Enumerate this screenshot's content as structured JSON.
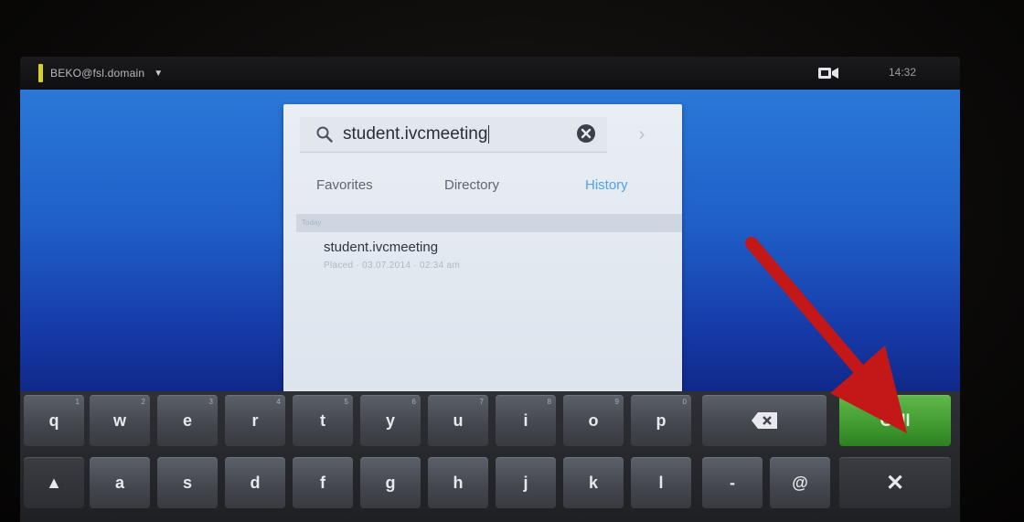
{
  "status_bar": {
    "account": "BEKO@fsl.domain",
    "account_caret": "▼",
    "clock": "14:32"
  },
  "search": {
    "query": "student.ivcmeeting",
    "next_glyph": "›"
  },
  "tabs": [
    {
      "label": "Favorites",
      "active": false
    },
    {
      "label": "Directory",
      "active": false
    },
    {
      "label": "History",
      "active": true
    }
  ],
  "history": {
    "section_label": "Today",
    "items": [
      {
        "name": "student.ivcmeeting",
        "meta": "Placed · 03.07.2014 · 02:34 am"
      }
    ]
  },
  "keyboard": {
    "row1": [
      {
        "label": "q",
        "alt": "1"
      },
      {
        "label": "w",
        "alt": "2"
      },
      {
        "label": "e",
        "alt": "3"
      },
      {
        "label": "r",
        "alt": "4"
      },
      {
        "label": "t",
        "alt": "5"
      },
      {
        "label": "y",
        "alt": "6"
      },
      {
        "label": "u",
        "alt": "7"
      },
      {
        "label": "i",
        "alt": "8"
      },
      {
        "label": "o",
        "alt": "9"
      },
      {
        "label": "p",
        "alt": "0"
      }
    ],
    "row2": [
      {
        "label": "▲"
      },
      {
        "label": "a"
      },
      {
        "label": "s"
      },
      {
        "label": "d"
      },
      {
        "label": "f"
      },
      {
        "label": "g"
      },
      {
        "label": "h"
      },
      {
        "label": "j"
      },
      {
        "label": "k"
      },
      {
        "label": "l"
      },
      {
        "label": "-"
      },
      {
        "label": "@"
      }
    ],
    "call_label": "Call",
    "close_label": "✕"
  },
  "colors": {
    "call_green": "#4aa83a",
    "history_accent": "#4aa6ee",
    "arrow_red": "#c41717"
  }
}
